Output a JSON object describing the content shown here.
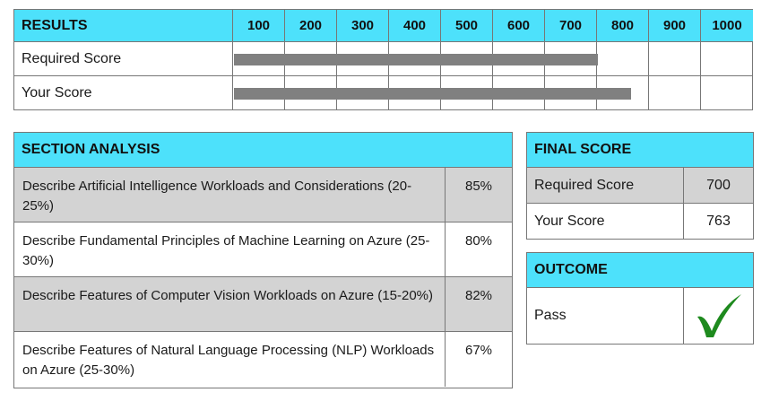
{
  "results": {
    "title": "RESULTS",
    "ticks": [
      "100",
      "200",
      "300",
      "400",
      "500",
      "600",
      "700",
      "800",
      "900",
      "1000"
    ],
    "rows": [
      {
        "label": "Required Score",
        "value": 700
      },
      {
        "label": "Your Score",
        "value": 763
      }
    ]
  },
  "section_analysis": {
    "title": "SECTION ANALYSIS",
    "rows": [
      {
        "description": "Describe Artificial Intelligence Workloads and Considerations (20-25%)",
        "percent": "85%"
      },
      {
        "description": "Describe Fundamental Principles of Machine Learning on Azure (25-30%)",
        "percent": "80%"
      },
      {
        "description": "Describe Features of Computer Vision Workloads on Azure (15-20%)",
        "percent": "82%"
      },
      {
        "description": "Describe Features of Natural Language Processing (NLP) Workloads on Azure (25-30%)",
        "percent": "67%"
      }
    ]
  },
  "final_score": {
    "title": "FINAL SCORE",
    "rows": [
      {
        "label": "Required Score",
        "value": "700"
      },
      {
        "label": "Your Score",
        "value": "763"
      }
    ]
  },
  "outcome": {
    "title": "OUTCOME",
    "label": "Pass",
    "icon": "checkmark-icon"
  },
  "colors": {
    "header": "#4de1fb",
    "shade": "#d3d3d3",
    "bar": "#808080",
    "check": "#1e8a1e"
  }
}
